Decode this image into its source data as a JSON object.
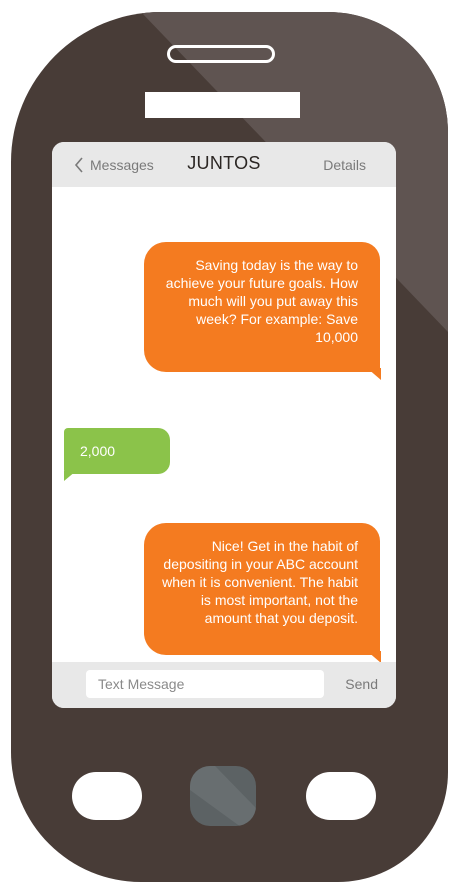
{
  "header": {
    "back_label": "Messages",
    "title": "JUNTOS",
    "details_label": "Details"
  },
  "messages": [
    {
      "direction": "outgoing",
      "text": "Saving today is the way to achieve your future goals. How much will you put away this week? For example: Save 10,000"
    },
    {
      "direction": "incoming",
      "text": "2,000"
    },
    {
      "direction": "outgoing",
      "text": "Nice! Get in the habit of depositing in your ABC account when it is convenient. The habit is most important, not the amount that you deposit."
    }
  ],
  "composer": {
    "placeholder": "Text Message",
    "send_label": "Send"
  },
  "colors": {
    "phone_body": "#483c37",
    "outgoing_bubble": "#f47b20",
    "incoming_bubble": "#8bc34a",
    "bar_background": "#e8e8e8"
  },
  "icons": {
    "back": "chevron-left-icon"
  }
}
